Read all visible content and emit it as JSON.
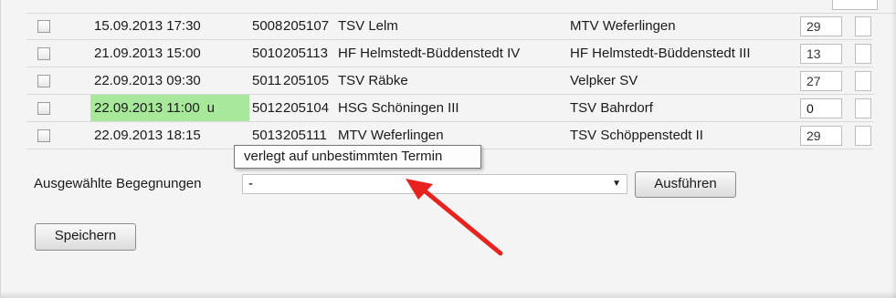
{
  "rows": [
    {
      "date": "15.09.2013 17:30",
      "flag": "",
      "num1": "5008",
      "num2": "205107",
      "home": "TSV Lelm",
      "guest": "MTV Weferlingen",
      "value": "29",
      "highlight": false
    },
    {
      "date": "21.09.2013 15:00",
      "flag": "",
      "num1": "5010",
      "num2": "205113",
      "home": "HF Helmstedt-Büddenstedt IV",
      "guest": "HF Helmstedt-Büddenstedt III",
      "value": "13",
      "highlight": false
    },
    {
      "date": "22.09.2013 09:30",
      "flag": "",
      "num1": "5011",
      "num2": "205105",
      "home": "TSV Räbke",
      "guest": "Velpker SV",
      "value": "27",
      "highlight": false
    },
    {
      "date": "22.09.2013 11:00",
      "flag": "u",
      "num1": "5012",
      "num2": "205104",
      "home": "HSG Schöningen III",
      "guest": "TSV Bahrdorf",
      "value": "0",
      "highlight": true
    },
    {
      "date": "22.09.2013 18:15",
      "flag": "",
      "num1": "5013",
      "num2": "205111",
      "home": "MTV Weferlingen",
      "guest": "TSV Schöppenstedt II",
      "value": "29",
      "highlight": false
    }
  ],
  "selection": {
    "label": "Ausgewählte Begegnungen",
    "value": "-",
    "run_button": "Ausführen"
  },
  "save_button": "Speichern",
  "tooltip": "verlegt auf unbestimmten Termin",
  "colors": {
    "highlight": "#a8e89a",
    "arrow": "#e8231e"
  }
}
